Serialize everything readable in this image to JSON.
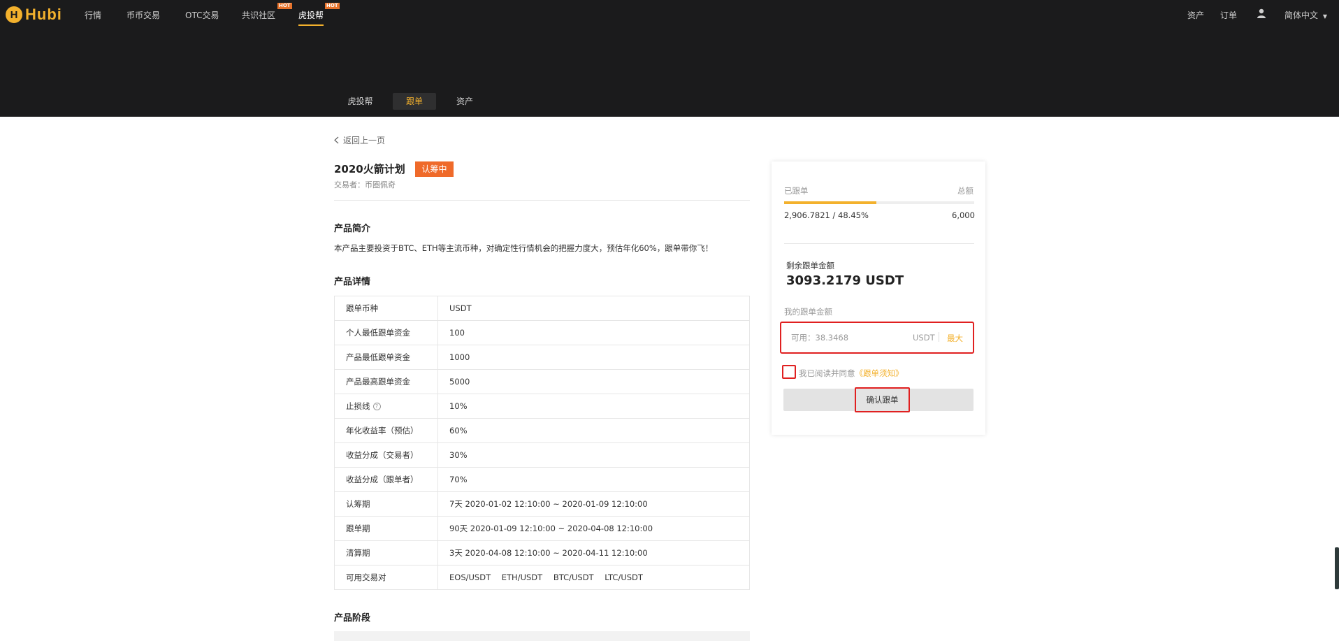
{
  "header": {
    "logo_text": "Hubi",
    "logo_mark": "H",
    "nav": [
      "行情",
      "币币交易",
      "OTC交易",
      "共识社区",
      "虎投帮"
    ],
    "hot_badge": "HOT",
    "right_nav": {
      "assets": "资产",
      "orders": "订单",
      "language": "简体中文"
    },
    "user_icon": "user-icon",
    "subnav": [
      "虎投帮",
      "跟单",
      "资产"
    ],
    "brand_color": "#f3b12d"
  },
  "page": {
    "back_label": "返回上一页",
    "title": "2020火箭计划",
    "status_badge": "认筹中",
    "trader": "交易者：币圈佩奇",
    "intro_heading": "产品简介",
    "intro_text": "本产品主要投资于BTC、ETH等主流币种，对确定性行情机会的把握力度大，预估年化60%，跟单带你飞！",
    "details_heading": "产品详情",
    "details": [
      {
        "key": "跟单币种",
        "value": "USDT"
      },
      {
        "key": "个人最低跟单资金",
        "value": "100"
      },
      {
        "key": "产品最低跟单资金",
        "value": "1000"
      },
      {
        "key": "产品最高跟单资金",
        "value": "5000"
      },
      {
        "key": "止损线",
        "value": "10%"
      },
      {
        "key": "年化收益率（预估）",
        "value": "60%"
      },
      {
        "key": "收益分成（交易者）",
        "value": "30%"
      },
      {
        "key": "收益分成（跟单者）",
        "value": "70%"
      },
      {
        "key": "认筹期",
        "value": "7天 2020-01-02 12:10:00 ~ 2020-01-09 12:10:00"
      },
      {
        "key": "跟单期",
        "value": "90天 2020-01-09 12:10:00 ~ 2020-04-08 12:10:00"
      },
      {
        "key": "清算期",
        "value": "3天 2020-04-08 12:10:00 ~ 2020-04-11 12:10:00"
      },
      {
        "key": "可用交易对",
        "pairs": [
          "EOS/USDT",
          "ETH/USDT",
          "BTC/USDT",
          "LTC/USDT"
        ]
      }
    ],
    "stage_heading": "产品阶段"
  },
  "card": {
    "followed_label": "已跟单",
    "total_label": "总额",
    "followed_value": "2,906.7821 / 48.45%",
    "progress_percent": 48.45,
    "total_value": "6,000",
    "remaining_label": "剩余跟单金额",
    "remaining_value": "3093.2179 USDT",
    "my_amount_label": "我的跟单金额",
    "amount_placeholder": "可用：38.3468",
    "unit": "USDT",
    "max_label": "最大",
    "agree_text": "我已阅读并同意",
    "agree_link": "《跟单须知》",
    "confirm_label": "确认跟单"
  }
}
